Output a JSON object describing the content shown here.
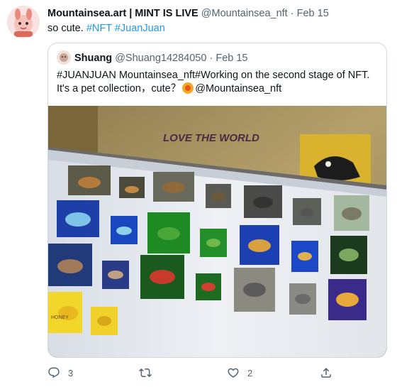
{
  "tweet": {
    "author_name": "Mountainsea.art | MINT IS LIVE",
    "handle": "@Mountainsea_nft",
    "separator": "·",
    "date": "Feb 15",
    "text": "so cute.",
    "hashtags": [
      "#NFT",
      "#JuanJuan"
    ]
  },
  "quote": {
    "author_name": "Shuang",
    "handle": "@Shuang14284050",
    "separator": "·",
    "date": "Feb 15",
    "line1": "#JUANJUAN Mountainsea_nft#Working on the second stage of NFT.",
    "line2_before": "It's a pet collection，cute？",
    "line2_after": "@Mountainsea_nft",
    "photo": {
      "banner_text": "LOVE THE WORLD",
      "card_text": "HONEY"
    }
  },
  "actions": {
    "reply_count": "3",
    "retweet_count": "",
    "like_count": "2"
  },
  "icons": {
    "reply": "reply-icon",
    "retweet": "retweet-icon",
    "like": "heart-icon",
    "share": "share-icon"
  },
  "colors": {
    "accent": "#1d9bf0",
    "muted": "#536471",
    "border": "#cfd9de"
  }
}
